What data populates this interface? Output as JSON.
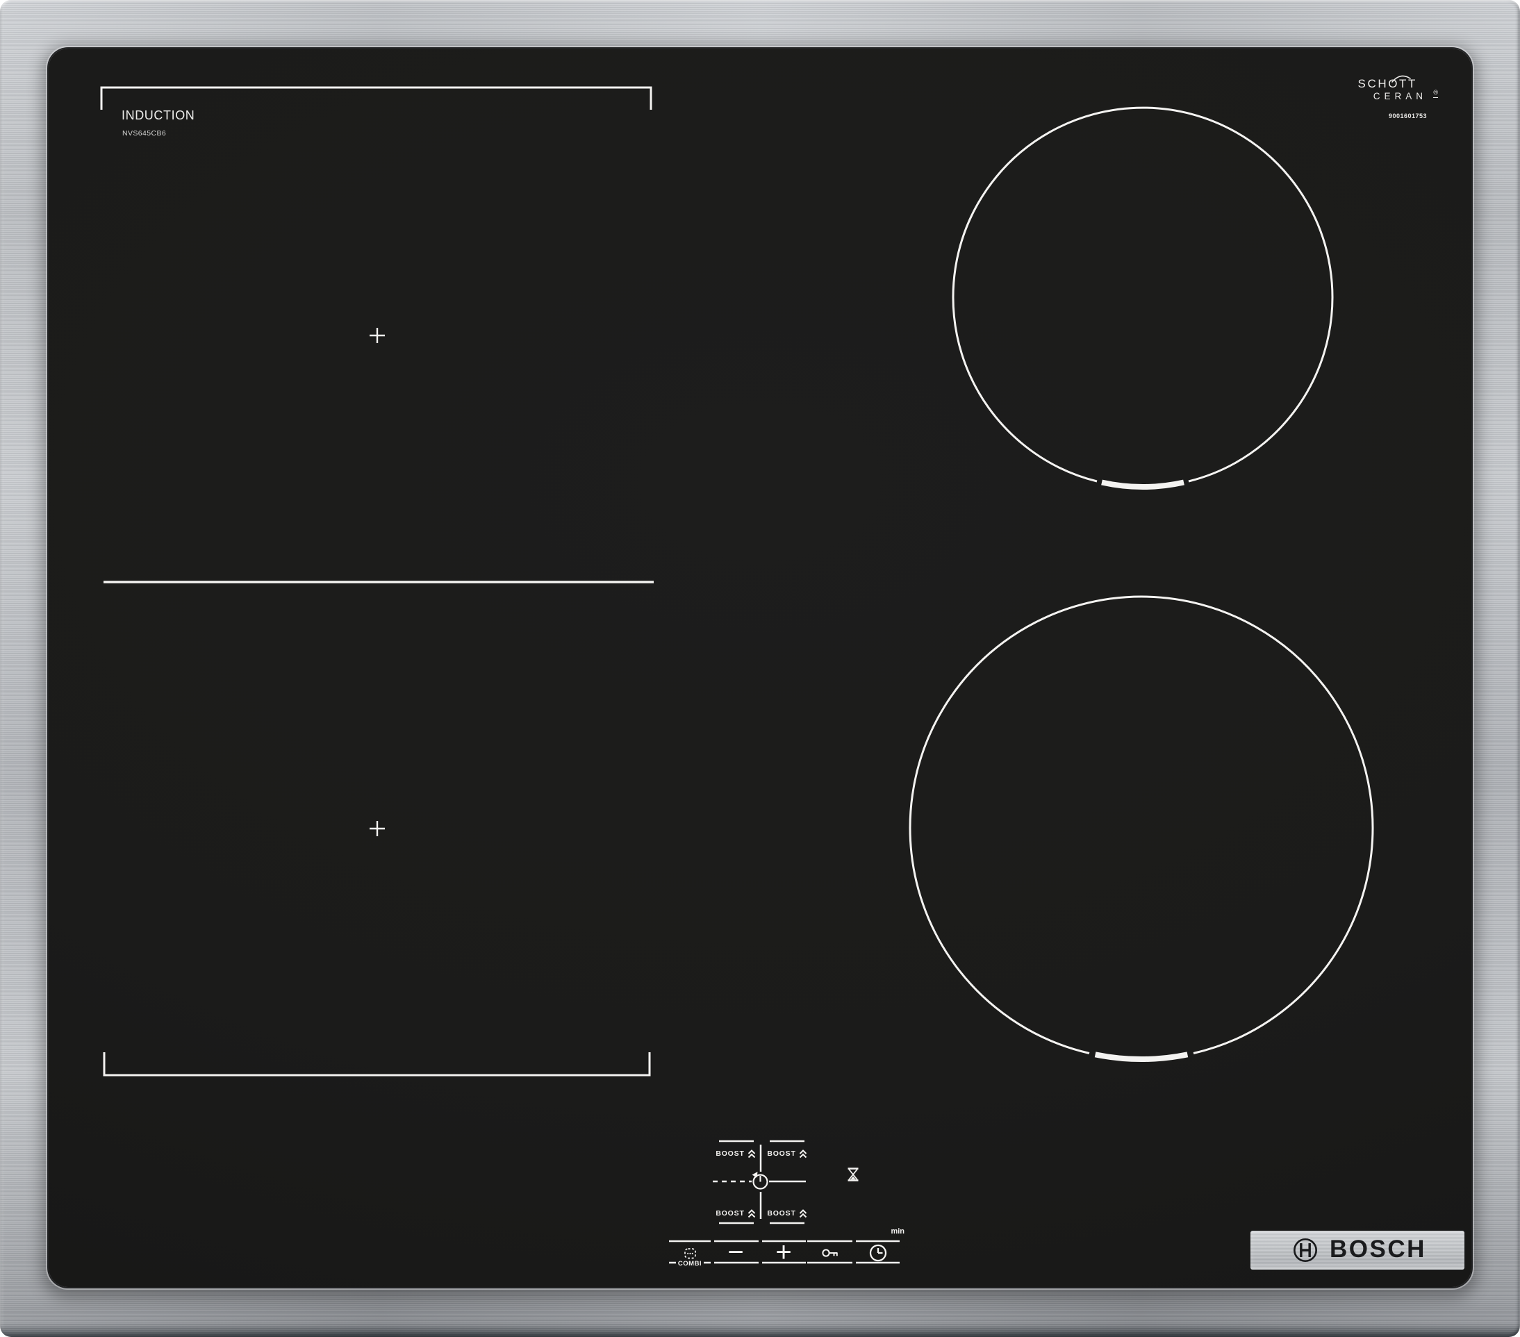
{
  "product": {
    "type_label": "INDUCTION",
    "model": "NVS645CB6",
    "glass_brand": {
      "line1": "SCHOTT",
      "line2": "CERAN",
      "registered": "®",
      "code": "9001601753"
    },
    "brand": "BOSCH"
  },
  "zones": {
    "flex_left": {
      "positions": 2,
      "pan_cross_symbol": "+"
    },
    "right_top_circle": {
      "marker": "pan-size-arc"
    },
    "right_bottom_circle": {
      "marker": "pan-size-arc"
    }
  },
  "controls": {
    "boost_zones": [
      {
        "label": "BOOST"
      },
      {
        "label": "BOOST"
      },
      {
        "label": "BOOST"
      },
      {
        "label": "BOOST"
      }
    ],
    "combi": {
      "label": "COMBI"
    },
    "decrease_symbol": "−",
    "increase_symbol": "+",
    "minutes_label": "min",
    "icons": {
      "boost": "double-chevron-up-icon",
      "timer_select": "timer-dial-icon",
      "timer_indicator": "hourglass-icon",
      "combi": "combi-zones-icon",
      "child_lock": "key-icon",
      "timer": "clock-icon",
      "brand": "bosch-emblem-icon"
    }
  },
  "colors": {
    "glass": "#1b1b1a",
    "marking": "#f4f3f1",
    "frame": "#b7babd",
    "logo_plate": "#c2c5c8",
    "logo_text": "#1a1b1d"
  }
}
